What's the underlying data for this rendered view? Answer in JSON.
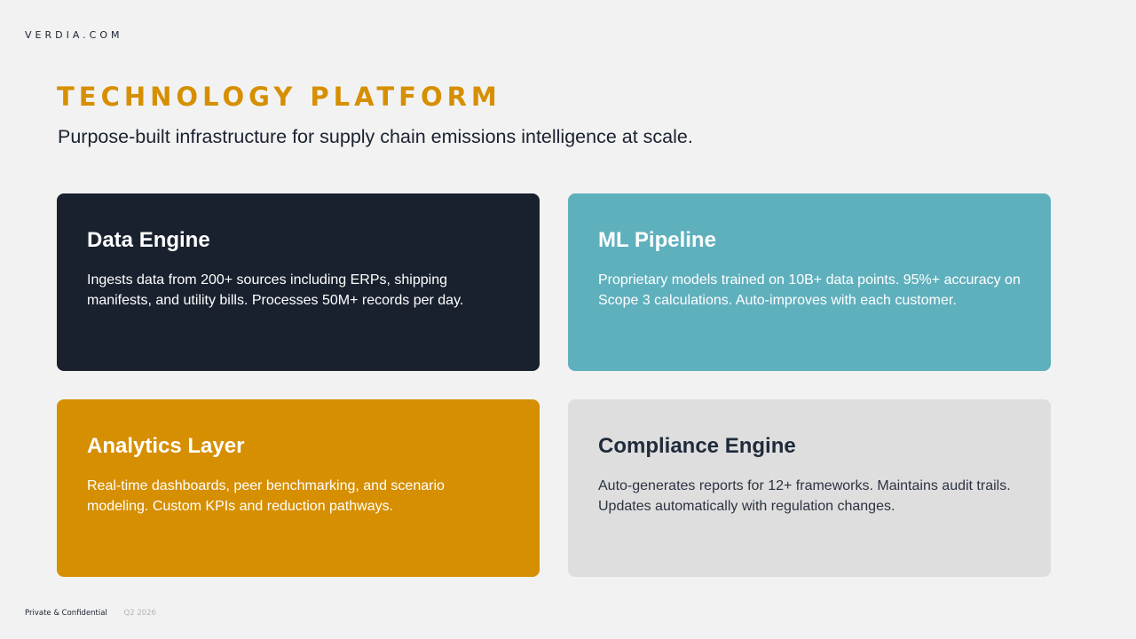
{
  "brand": "VERDIA.COM",
  "title": "TECHNOLOGY PLATFORM",
  "subtitle": "Purpose-built infrastructure for supply chain emissions intelligence at scale.",
  "cards": [
    {
      "title": "Data Engine",
      "body": "Ingests data from 200+ sources including ERPs, shipping manifests, and utility bills. Processes 50M+ records per day.",
      "color": "#19212e"
    },
    {
      "title": "ML Pipeline",
      "body": "Proprietary models trained on 10B+ data points. 95%+ accuracy on Scope 3 calculations. Auto-improves with each customer.",
      "color": "#5fb0bd"
    },
    {
      "title": "Analytics Layer",
      "body": "Real-time dashboards, peer benchmarking, and scenario modeling. Custom KPIs and reduction pathways.",
      "color": "#d68f00"
    },
    {
      "title": "Compliance Engine",
      "body": "Auto-generates reports for 12+ frameworks. Maintains audit trails. Updates automatically with regulation changes.",
      "color": "#dedede"
    }
  ],
  "footer": {
    "confidential": "Private & Confidential",
    "period": "Q2 2026"
  },
  "colors": {
    "accent": "#d68f00",
    "navy": "#19212e",
    "teal": "#5fb0bd",
    "background": "#f2f2f2"
  }
}
